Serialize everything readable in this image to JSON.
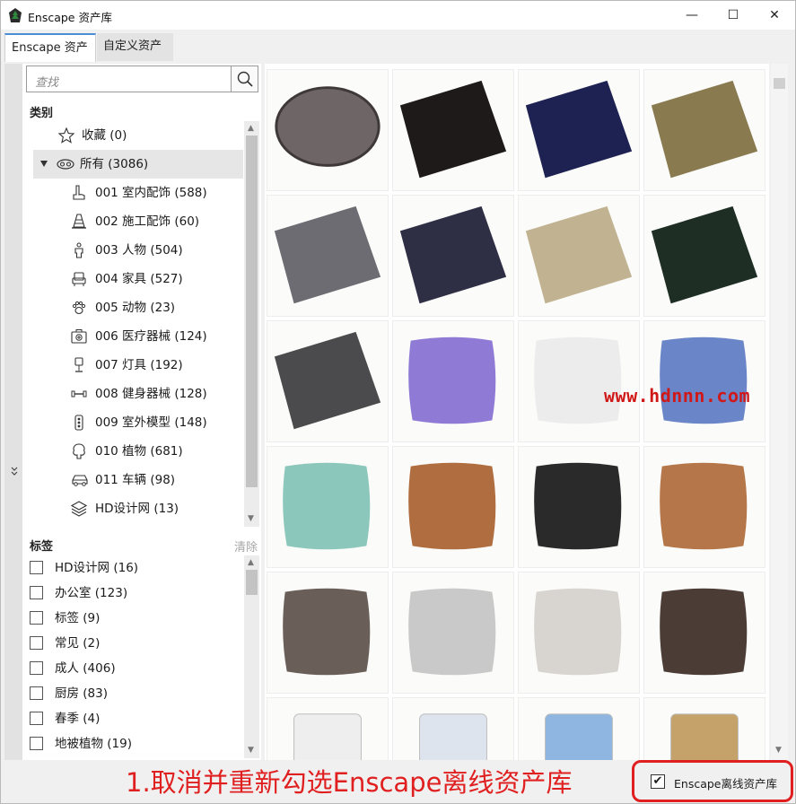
{
  "window": {
    "title": "Enscape 资产库",
    "minimize": "—",
    "maximize": "☐",
    "close": "✕"
  },
  "tabs": [
    {
      "label": "Enscape 资产",
      "active": true
    },
    {
      "label": "自定义资产",
      "active": false
    }
  ],
  "search": {
    "placeholder": "查找"
  },
  "categories": {
    "title": "类别",
    "items": [
      {
        "label": "收藏 (0)",
        "icon": "star-icon"
      },
      {
        "label": "所有 (3086)",
        "icon": "all-assets-icon",
        "expanded": true,
        "selected": true
      },
      {
        "label": "001 室内配饰 (588)",
        "icon": "interior-decor-icon"
      },
      {
        "label": "002 施工配饰 (60)",
        "icon": "traffic-cone-icon"
      },
      {
        "label": "003 人物 (504)",
        "icon": "person-icon"
      },
      {
        "label": "004 家具 (527)",
        "icon": "chair-icon"
      },
      {
        "label": "005 动物 (23)",
        "icon": "paw-icon"
      },
      {
        "label": "006 医疗器械 (124)",
        "icon": "medical-kit-icon"
      },
      {
        "label": "007 灯具 (192)",
        "icon": "lamp-icon"
      },
      {
        "label": "008 健身器械 (128)",
        "icon": "dumbbell-icon"
      },
      {
        "label": "009 室外模型 (148)",
        "icon": "traffic-light-icon"
      },
      {
        "label": "010 植物 (681)",
        "icon": "tree-icon"
      },
      {
        "label": "011 车辆 (98)",
        "icon": "car-icon"
      },
      {
        "label": "HD设计网 (13)",
        "icon": "layers-icon"
      }
    ]
  },
  "tags": {
    "title": "标签",
    "clear_label": "清除",
    "items": [
      {
        "label": "HD设计网 (16)"
      },
      {
        "label": "办公室 (123)"
      },
      {
        "label": "标签 (9)"
      },
      {
        "label": "常见 (2)"
      },
      {
        "label": "成人 (406)"
      },
      {
        "label": "厨房 (83)"
      },
      {
        "label": "春季 (4)"
      },
      {
        "label": "地被植物 (19)"
      }
    ]
  },
  "assets": [
    {
      "name": "manhole-cover-thumbnail",
      "color": "#6e6566"
    },
    {
      "name": "chevron-rug-thumbnail",
      "color": "#1f1a1a"
    },
    {
      "name": "navy-rug-thumbnail",
      "color": "#1e2253"
    },
    {
      "name": "olive-rug-thumbnail",
      "color": "#8a7a50"
    },
    {
      "name": "gray-geometric-rug-thumbnail",
      "color": "#6c6c72"
    },
    {
      "name": "dark-blue-rug-thumbnail",
      "color": "#2e2f45"
    },
    {
      "name": "beige-rug-thumbnail",
      "color": "#c1b391"
    },
    {
      "name": "dark-green-rug-thumbnail",
      "color": "#1e2e24"
    },
    {
      "name": "charcoal-rug-thumbnail",
      "color": "#4b4a4c"
    },
    {
      "name": "purple-chevron-pillow-thumbnail",
      "color": "#8f7bd6"
    },
    {
      "name": "white-pillow-thumbnail",
      "color": "#ececec"
    },
    {
      "name": "leaf-pillow-thumbnail",
      "color": "#6a86c8"
    },
    {
      "name": "teal-leaf-pillow-thumbnail",
      "color": "#8cc7bb"
    },
    {
      "name": "leather-pillow-thumbnail",
      "color": "#b06d3f"
    },
    {
      "name": "triangle-pillow-thumbnail",
      "color": "#2a2a2a"
    },
    {
      "name": "half-leather-pillow-thumbnail",
      "color": "#b5764a"
    },
    {
      "name": "stripe-block-pillow-thumbnail",
      "color": "#6a5e58"
    },
    {
      "name": "gray-pillow-thumbnail",
      "color": "#c9c9c9"
    },
    {
      "name": "grid-pillow-thumbnail",
      "color": "#d8d5d0"
    },
    {
      "name": "aztec-pillow-thumbnail",
      "color": "#4b3d36"
    },
    {
      "name": "speaker-thumbnail",
      "color": "#eeeeee"
    },
    {
      "name": "subwoofer-thumbnail",
      "color": "#dde4ee"
    },
    {
      "name": "ottoman-thumbnail",
      "color": "#8eb6e0"
    },
    {
      "name": "cabinet-thumbnail",
      "color": "#c4a26a"
    }
  ],
  "watermark": "www.hdnnn.com",
  "annotation": "1.取消并重新勾选Enscape离线资产库",
  "offline": {
    "label": "Enscape离线资产库",
    "checked": true,
    "check_glyph": "✔"
  },
  "colors": {
    "accent": "#4a8fd6",
    "annotation_red": "#e02020"
  }
}
